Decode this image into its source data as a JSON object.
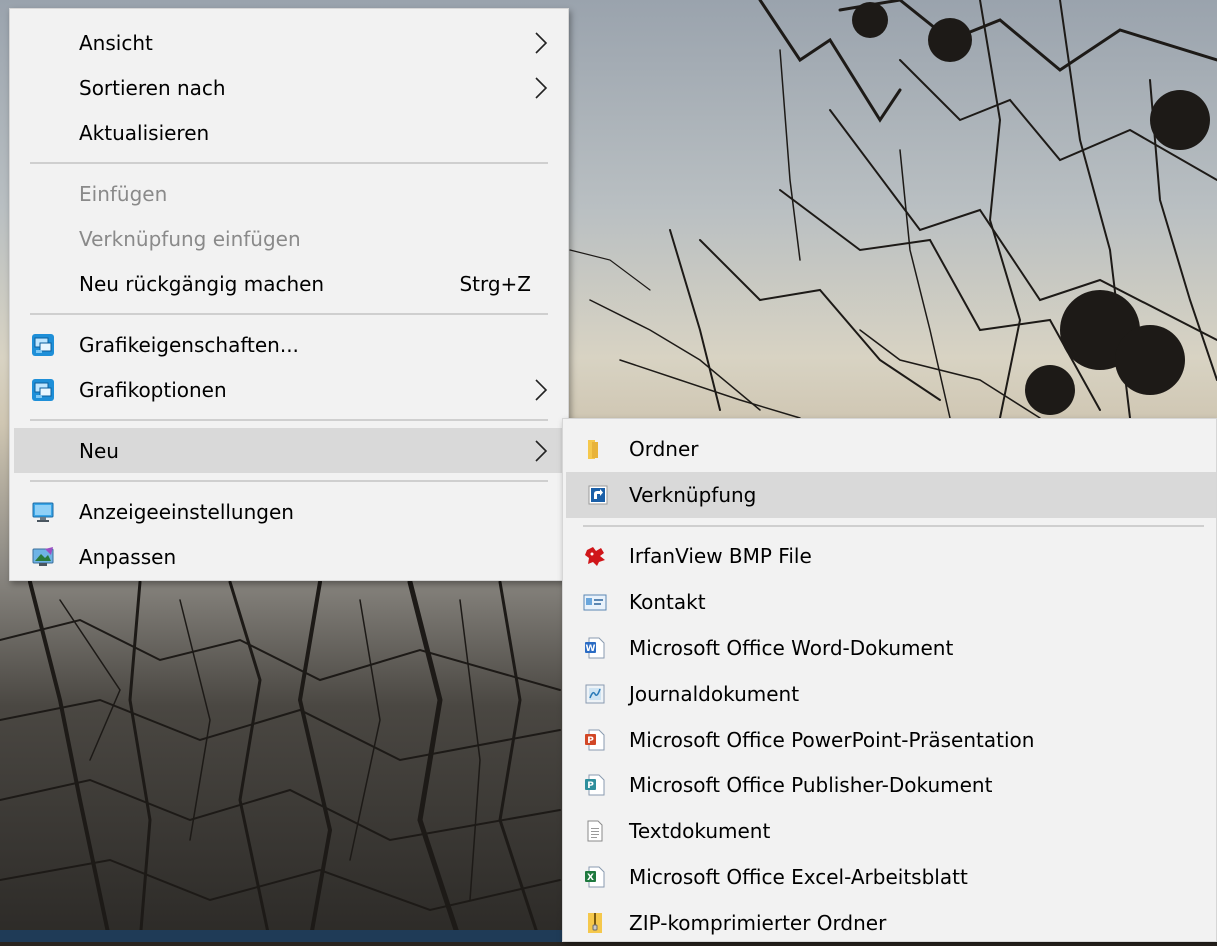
{
  "main_menu": {
    "groups": [
      [
        {
          "label": "Ansicht",
          "submenu": true
        },
        {
          "label": "Sortieren nach",
          "submenu": true
        },
        {
          "label": "Aktualisieren"
        }
      ],
      [
        {
          "label": "Einfügen",
          "disabled": true
        },
        {
          "label": "Verknüpfung einfügen",
          "disabled": true
        },
        {
          "label": "Neu rückgängig machen",
          "shortcut": "Strg+Z"
        }
      ],
      [
        {
          "label": "Grafikeigenschaften...",
          "icon": "intel-graphics-icon"
        },
        {
          "label": "Grafikoptionen",
          "icon": "intel-graphics-icon",
          "submenu": true
        }
      ],
      [
        {
          "label": "Neu",
          "submenu": true,
          "hover": true
        }
      ],
      [
        {
          "label": "Anzeigeeinstellungen",
          "icon": "display-settings-icon"
        },
        {
          "label": "Anpassen",
          "icon": "personalize-icon"
        }
      ]
    ]
  },
  "sub_menu": {
    "groups": [
      [
        {
          "label": "Ordner",
          "icon": "folder-icon"
        },
        {
          "label": "Verknüpfung",
          "icon": "shortcut-icon",
          "hover": true
        }
      ],
      [
        {
          "label": "IrfanView BMP File",
          "icon": "irfanview-icon"
        },
        {
          "label": "Kontakt",
          "icon": "contact-icon"
        },
        {
          "label": "Microsoft Office Word-Dokument",
          "icon": "word-document-icon"
        },
        {
          "label": "Journaldokument",
          "icon": "journal-document-icon"
        },
        {
          "label": "Microsoft Office PowerPoint-Präsentation",
          "icon": "powerpoint-document-icon"
        },
        {
          "label": "Microsoft Office Publisher-Dokument",
          "icon": "publisher-document-icon"
        },
        {
          "label": "Textdokument",
          "icon": "text-document-icon"
        },
        {
          "label": "Microsoft Office Excel-Arbeitsblatt",
          "icon": "excel-document-icon"
        },
        {
          "label": "ZIP-komprimierter Ordner",
          "icon": "zip-folder-icon"
        }
      ]
    ]
  },
  "colors": {
    "menu_background": "#f2f2f2",
    "hover_background": "#d9d9d9",
    "disabled_text": "#8a8a8a",
    "separator": "#cfcfcf"
  }
}
